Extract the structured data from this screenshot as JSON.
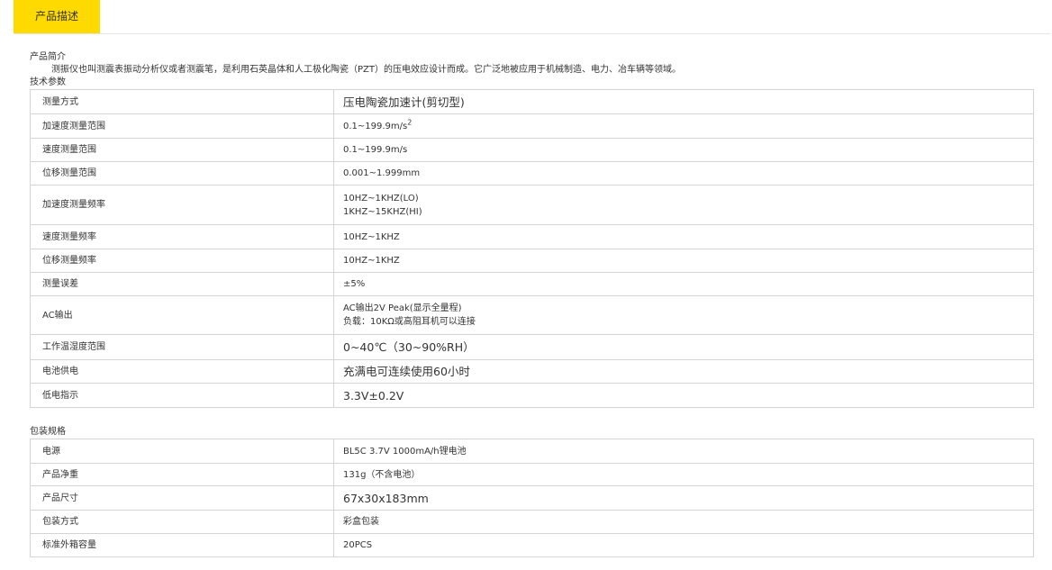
{
  "tabs": {
    "active_label": "产品描述",
    "active_color": "#ffda00"
  },
  "intro": {
    "title": "产品简介",
    "text": "测振仪也叫测震表振动分析仪或者测震笔，是利用石英晶体和人工极化陶瓷（PZT）的压电效应设计而成。它广泛地被应用于机械制造、电力、冶车辆等领域。"
  },
  "tech": {
    "title": "技术参数",
    "rows": [
      {
        "key": "测量方式",
        "lines": [
          "压电陶瓷加速计(剪切型)"
        ],
        "big": true
      },
      {
        "key": "加速度测量范围",
        "lines": [
          "0.1~199.9m/s"
        ],
        "sup": "2"
      },
      {
        "key": "速度测量范围",
        "lines": [
          "0.1~199.9m/s"
        ]
      },
      {
        "key": "位移测量范围",
        "lines": [
          "0.001~1.999mm"
        ]
      },
      {
        "key": "加速度测量频率",
        "lines": [
          "10HZ~1KHZ(LO)",
          "1KHZ~15KHZ(HI)"
        ]
      },
      {
        "key": "速度测量频率",
        "lines": [
          "10HZ~1KHZ"
        ]
      },
      {
        "key": "位移测量频率",
        "lines": [
          "10HZ~1KHZ"
        ]
      },
      {
        "key": "测量误差",
        "lines": [
          "±5%"
        ]
      },
      {
        "key": "AC输出",
        "lines": [
          "AC输出2V Peak(显示全量程)",
          "负载：10KΩ或高阻耳机可以连接"
        ]
      },
      {
        "key": "工作温湿度范围",
        "lines": [
          "0~40℃（30~90%RH）"
        ],
        "big": true
      },
      {
        "key": "电池供电",
        "lines": [
          "充满电可连续使用60小时"
        ],
        "big": true
      },
      {
        "key": "低电指示",
        "lines": [
          "3.3V±0.2V"
        ],
        "big": true
      }
    ]
  },
  "pack": {
    "title": "包装规格",
    "rows": [
      {
        "key": "电源",
        "lines": [
          "BL5C 3.7V 1000mA/h锂电池"
        ]
      },
      {
        "key": "产品净重",
        "lines": [
          "131g（不含电池）"
        ]
      },
      {
        "key": "产品尺寸",
        "lines": [
          "67x30x183mm"
        ],
        "big": true
      },
      {
        "key": "包装方式",
        "lines": [
          "彩盒包装"
        ]
      },
      {
        "key": "标准外箱容量",
        "lines": [
          "20PCS"
        ]
      }
    ]
  }
}
